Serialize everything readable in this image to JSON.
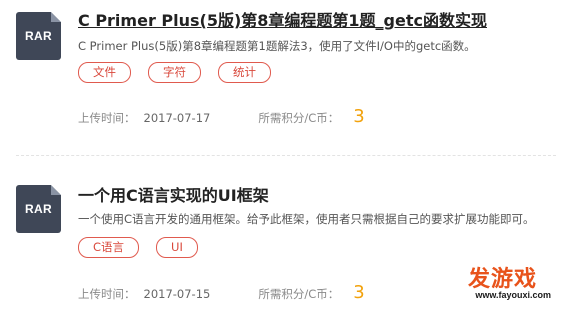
{
  "items": [
    {
      "file_type": "RAR",
      "title": "C Primer Plus(5版)第8章编程题第1题_getc函数实现",
      "description": "C Primer Plus(5版)第8章编程题第1题解法3，使用了文件I/O中的getc函数。",
      "tags": [
        "文件",
        "字符",
        "统计"
      ],
      "upload_label": "上传时间：",
      "upload_date": "2017-07-17",
      "points_label": "所需积分/C币：",
      "points": "3"
    },
    {
      "file_type": "RAR",
      "title": "一个用C语言实现的UI框架",
      "description": "一个使用C语言开发的通用框架。给予此框架，使用者只需根据自己的要求扩展功能即可。",
      "tags": [
        "C语言",
        "UI"
      ],
      "upload_label": "上传时间：",
      "upload_date": "2017-07-15",
      "points_label": "所需积分/C币：",
      "points": "3"
    }
  ],
  "watermark": {
    "main": "发游戏",
    "url": "www.fayouxi.com"
  },
  "colors": {
    "accent_tag": "#e05a4e",
    "points": "#f2a20c",
    "file_icon_bg": "#3f4757"
  }
}
